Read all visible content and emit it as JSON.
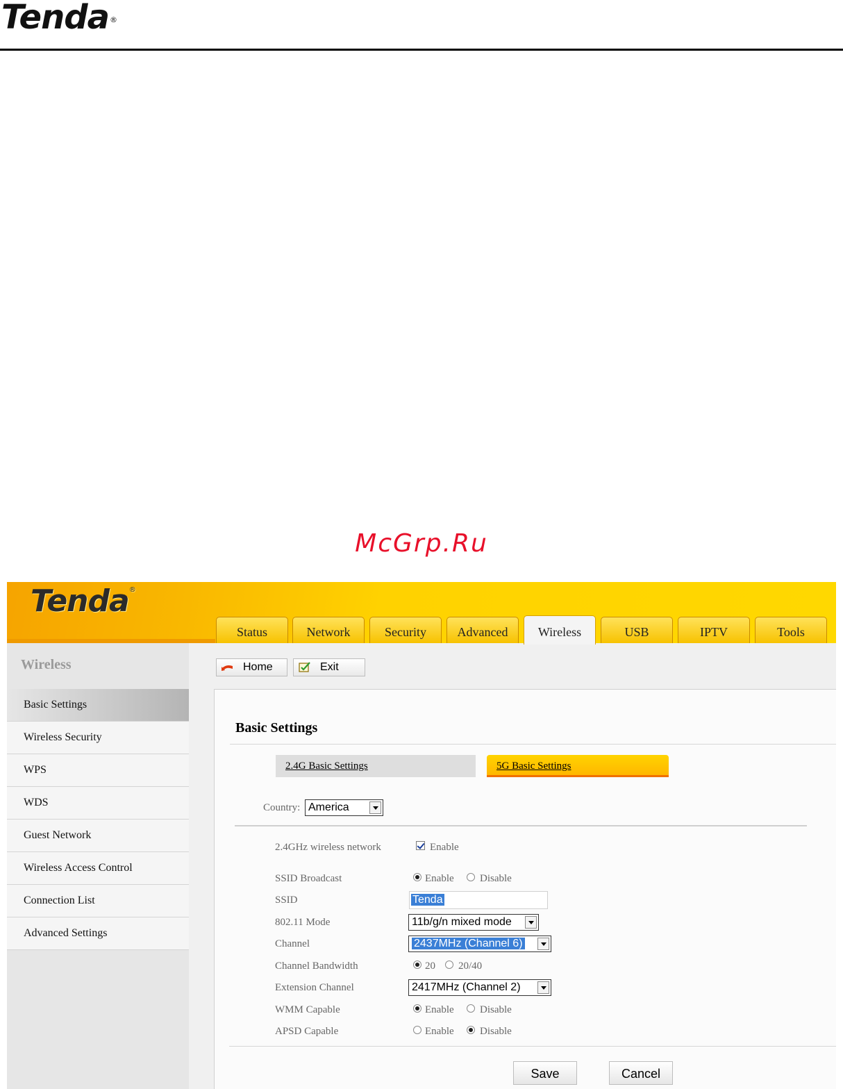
{
  "page": {
    "logo": "Tenda",
    "logo_mark": "®",
    "watermark": "McGrp.Ru"
  },
  "router": {
    "logo": "Tenda",
    "logo_mark": "®",
    "tabs": [
      {
        "label": "Status"
      },
      {
        "label": "Network"
      },
      {
        "label": "Security"
      },
      {
        "label": "Advanced"
      },
      {
        "label": "Wireless",
        "active": true
      },
      {
        "label": "USB"
      },
      {
        "label": "IPTV"
      },
      {
        "label": "Tools"
      }
    ],
    "sidebar": {
      "title": "Wireless",
      "items": [
        {
          "label": "Basic Settings",
          "active": true
        },
        {
          "label": "Wireless Security"
        },
        {
          "label": "WPS"
        },
        {
          "label": "WDS"
        },
        {
          "label": "Guest Network"
        },
        {
          "label": "Wireless Access Control"
        },
        {
          "label": "Connection List"
        },
        {
          "label": "Advanced Settings"
        }
      ]
    },
    "toolbar": {
      "home": "Home",
      "exit": "Exit"
    },
    "content": {
      "title": "Basic Settings",
      "subtab_24": "2.4G Basic Settings",
      "subtab_5g": "5G Basic Settings",
      "country_label": "Country:",
      "country_value": "America",
      "wireless_label": "2.4GHz wireless network",
      "wireless_enable": "Enable",
      "ssid_broadcast_label": "SSID Broadcast",
      "ssid_broadcast_enable": "Enable",
      "ssid_broadcast_disable": "Disable",
      "ssid_label": "SSID",
      "ssid_value": "Tenda",
      "mode_label": "802.11 Mode",
      "mode_value": "11b/g/n mixed mode",
      "channel_label": "Channel",
      "channel_value": "2437MHz (Channel 6)",
      "bandwidth_label": "Channel Bandwidth",
      "bandwidth_20": "20",
      "bandwidth_2040": "20/40",
      "ext_channel_label": "Extension Channel",
      "ext_channel_value": "2417MHz (Channel 2)",
      "wmm_label": "WMM Capable",
      "wmm_enable": "Enable",
      "wmm_disable": "Disable",
      "apsd_label": "APSD Capable",
      "apsd_enable": "Enable",
      "apsd_disable": "Disable",
      "save": "Save",
      "cancel": "Cancel"
    }
  }
}
